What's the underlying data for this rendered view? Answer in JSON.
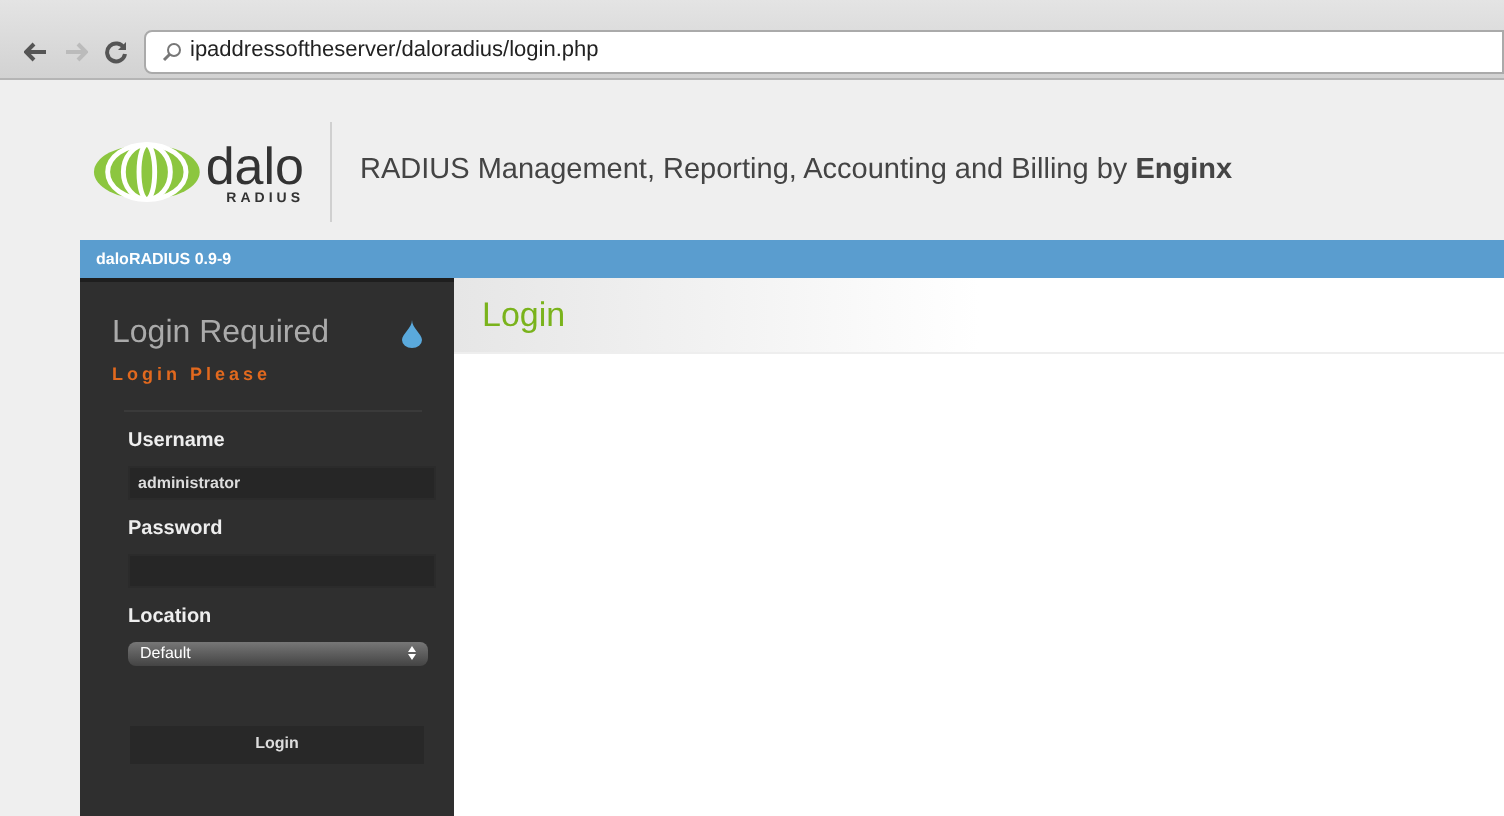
{
  "browser": {
    "url": "ipaddressoftheserver/daloradius/login.php"
  },
  "header": {
    "logo_word": "dalo",
    "logo_sub": "RADIUS",
    "tagline": "RADIUS Management, Reporting, Accounting and Billing by **Enginx**"
  },
  "version_bar": "daloRADIUS 0.9-9",
  "sidebar": {
    "title": "Login Required",
    "subtitle": "Login Please",
    "fields": [
      {
        "kind": "text",
        "label": "Username",
        "value": "administrator"
      },
      {
        "kind": "password",
        "label": "Password"
      },
      {
        "kind": "select",
        "label": "Location",
        "value": "Default"
      }
    ],
    "button": "Login"
  },
  "content": {
    "heading": "Login"
  }
}
